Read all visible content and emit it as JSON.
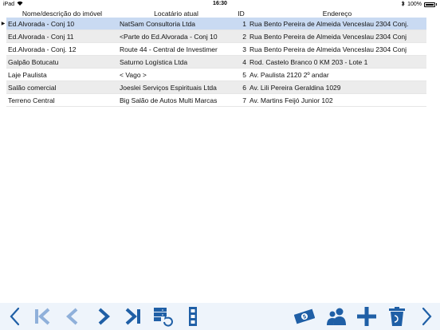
{
  "status_bar": {
    "device": "iPad",
    "time": "16:30",
    "battery": "100%"
  },
  "table": {
    "columns": [
      "Nome/descrição do imóvel",
      "Locatário atual",
      "ID",
      "Endereço"
    ],
    "rows": [
      {
        "nome": "Ed.Alvorada - Conj 10",
        "locatario": "NatSam Consultoria Ltda",
        "id": "1",
        "endereco": "Rua Bento Pereira de Almeida Venceslau 2304  Conj.",
        "selected": true
      },
      {
        "nome": "Ed.Alvorada - Conj 11",
        "locatario": "<Parte do Ed.Alvorada - Conj 10",
        "id": "2",
        "endereco": "Rua Bento Pereira de Almeida Venceslau 2304  Conj"
      },
      {
        "nome": "Ed.Alvorada - Conj. 12",
        "locatario": "Route 44 - Central de Investimer",
        "id": "3",
        "endereco": "Rua Bento Pereira de Almeida Venceslau 2304  Conj"
      },
      {
        "nome": "Galpão Botucatu",
        "locatario": "Saturno Logística Ltda",
        "id": "4",
        "endereco": "Rod. Castelo Branco 0  KM 203 - Lote 1"
      },
      {
        "nome": "Laje Paulista",
        "locatario": "< Vago >",
        "id": "5",
        "endereco": "Av. Paulista 2120  2º andar"
      },
      {
        "nome": "Salão comercial",
        "locatario": "Joeslei Serviços Espirituais Ltda",
        "id": "6",
        "endereco": "Av. Lili Pereira Geraldina 1029"
      },
      {
        "nome": "Terreno Central",
        "locatario": "Big Salão de Autos Multi Marcas",
        "id": "7",
        "endereco": "Av. Martins Feijó Junior 102"
      }
    ]
  },
  "toolbar": {
    "icons": [
      "chevron-left-icon",
      "first-record-icon",
      "previous-record-icon",
      "next-record-icon",
      "last-record-icon",
      "refresh-records-icon",
      "columns-icon",
      "money-icon",
      "users-icon",
      "add-icon",
      "trash-icon",
      "chevron-right-icon"
    ]
  },
  "colors": {
    "accent": "#1f5fa6",
    "light_accent": "#8fb0da",
    "selected_row": "#c9daf2",
    "alt_row": "#ececec",
    "toolbar_bg": "#eef4fb"
  }
}
